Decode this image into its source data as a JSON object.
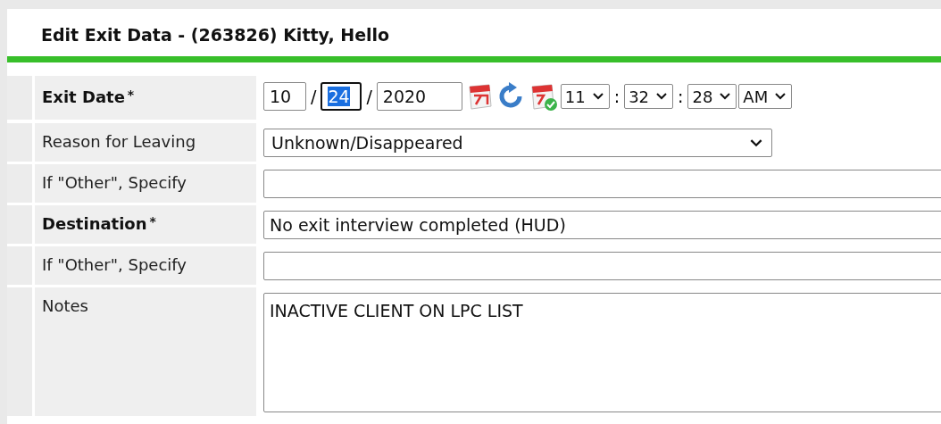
{
  "panel": {
    "title": "Edit Exit Data - (263826) Kitty, Hello"
  },
  "rows": [
    {
      "kind": "datetime",
      "label": "Exit Date",
      "required": true,
      "required_mark": "*",
      "date": {
        "month": "10",
        "day": "24",
        "year": "2020",
        "separator": "/",
        "day_focused": true
      },
      "time": {
        "hour": "11",
        "minute": "32",
        "second": "28",
        "ampm": "AM",
        "separator": ":"
      }
    },
    {
      "kind": "select",
      "label": "Reason for Leaving",
      "required": false,
      "value": "Unknown/Disappeared"
    },
    {
      "kind": "text",
      "label": "If \"Other\", Specify",
      "required": false
    },
    {
      "kind": "wide",
      "label": "Destination",
      "required": true,
      "required_mark": "*",
      "value": "No exit interview completed (HUD)"
    },
    {
      "kind": "text",
      "label": "If \"Other\", Specify",
      "required": false
    },
    {
      "kind": "textarea",
      "label": "Notes",
      "required": false,
      "value": "INACTIVE CLIENT ON LPC LIST"
    }
  ]
}
